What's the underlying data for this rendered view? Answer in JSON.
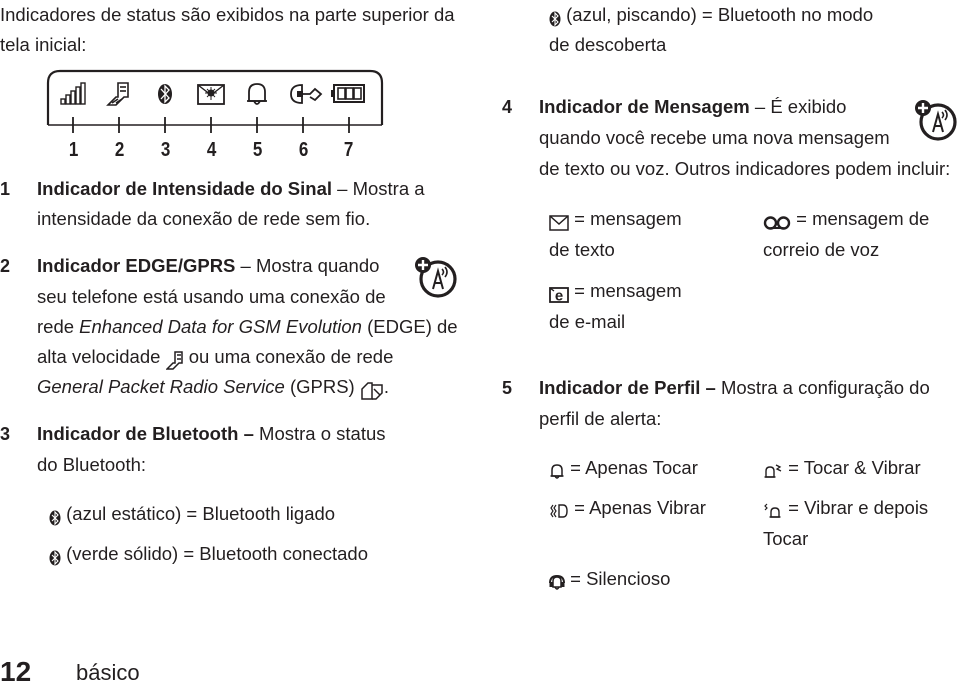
{
  "intro": {
    "line1": "Indicadores de status são exibidos na parte superior da",
    "line2": "tela inicial:"
  },
  "diagram": {
    "icons": [
      {
        "number": "1",
        "icon": "signal-strength-icon"
      },
      {
        "number": "2",
        "icon": "edge-icon"
      },
      {
        "number": "3",
        "icon": "bluetooth-icon"
      },
      {
        "number": "4",
        "icon": "message-icon"
      },
      {
        "number": "5",
        "icon": "ring-bell-icon"
      },
      {
        "number": "6",
        "icon": "headset-forward-icon"
      },
      {
        "number": "7",
        "icon": "battery-icon"
      }
    ]
  },
  "items": {
    "i1": {
      "number": "1",
      "title": "Indicador de Intensidade do Sinal",
      "dash": " – ",
      "text1": "Mostra a",
      "text2": "intensidade da conexão de rede sem fio."
    },
    "i2": {
      "number": "2",
      "title": "Indicador EDGE/GPRS",
      "dash": " – ",
      "text1": "Mostra quando",
      "text2": "seu telefone está usando uma conexão de",
      "text3a": "rede ",
      "text3i": "Enhanced Data for GSM Evolution",
      "text3b": " (EDGE) de",
      "text4a": "alta velocidade ",
      "text4b": " ou uma conexão de rede",
      "text5i": "General Packet Radio Service",
      "text5b": " (GPRS) ",
      "text5c": "."
    },
    "i3": {
      "number": "3",
      "title": "Indicador de Bluetooth",
      "dash": " – ",
      "text1": "Mostra o status",
      "text2": "do Bluetooth:",
      "states": [
        {
          "text": " (azul estático) = Bluetooth ligado"
        },
        {
          "text": " (verde sólido) = Bluetooth conectado"
        },
        {
          "text": " (azul, piscando) = Bluetooth no modo",
          "text2": "de descoberta"
        }
      ]
    },
    "i4": {
      "number": "4",
      "title": "Indicador de Mensagem",
      "dash": " – ",
      "text1": "É exibido",
      "text2": "quando você recebe uma nova mensagem",
      "text3": "de texto ou voz. Outros indicadores podem incluir:",
      "types": [
        {
          "icon": "text-message-icon",
          "label": " = mensagem",
          "label2": "de texto"
        },
        {
          "icon": "voicemail-icon",
          "label": " = mensagem de",
          "label2": "correio de voz"
        },
        {
          "icon": "email-icon",
          "label": " = mensagem",
          "label2": "de e-mail"
        }
      ]
    },
    "i5": {
      "number": "5",
      "title": "Indicador de Perfil",
      "dash": " – ",
      "text1": "Mostra a configuração do",
      "text2": "perfil de alerta:",
      "profiles": [
        {
          "icon": "ring-only-icon",
          "label": " = Apenas Tocar"
        },
        {
          "icon": "ring-vibrate-icon",
          "label": " = Tocar & Vibrar"
        },
        {
          "icon": "vibrate-only-icon",
          "label": " = Apenas Vibrar"
        },
        {
          "icon": "vibrate-then-ring-icon",
          "label": " = Vibrar e depois",
          "label2": "Tocar"
        },
        {
          "icon": "silent-icon",
          "label": " = Silencioso"
        }
      ]
    }
  },
  "footer": {
    "page_number": "12",
    "section": "básico"
  }
}
